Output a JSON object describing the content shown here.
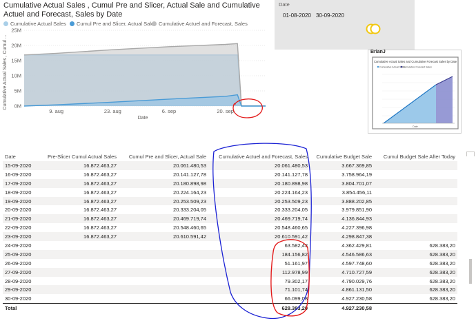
{
  "chart": {
    "title": "Cumulative Actual Sales , Cumul Pre and Slicer, Actual Sale and Cumulative Actuel and Forecast, Sales by Date",
    "legend": [
      {
        "label": "Cumulative Actual Sales",
        "color": "#a9cfe8"
      },
      {
        "label": "Cumul Pre and Slicer, Actual Sale",
        "color": "#4a9bd6"
      },
      {
        "label": "Cumulative Actuel and Forecast, Sales",
        "color": "#bdbdbd"
      }
    ],
    "ylabel": "Cumulative Actual Sales , Cumul ...",
    "xlabel": "Date"
  },
  "chart_data": {
    "type": "area",
    "x": [
      "2020-08-01",
      "2020-08-09",
      "2020-08-23",
      "2020-09-06",
      "2020-09-20",
      "2020-09-23",
      "2020-09-24",
      "2020-09-30"
    ],
    "x_tick_labels": [
      "9. aug",
      "23. aug",
      "6. sep",
      "20. sep"
    ],
    "y_tick_labels": [
      "0M",
      "5M",
      "10M",
      "15M",
      "20M",
      "25M"
    ],
    "ylim": [
      0,
      25000000
    ],
    "series": [
      {
        "name": "Cumulative Actual Sales",
        "values": [
          16872463,
          16872463,
          16872463,
          16872463,
          16872463,
          16872463,
          0,
          0
        ]
      },
      {
        "name": "Cumulative Actuel and Forecast, Sales",
        "values": [
          16872463,
          17400000,
          18600000,
          19600000,
          20333000,
          20610591,
          63582,
          66099
        ]
      },
      {
        "name": "Cumul Pre and Slicer, Actual Sale",
        "values": [
          0,
          400000,
          1300000,
          2300000,
          3200000,
          3738128,
          0,
          0
        ]
      }
    ],
    "grid": true,
    "legend_position": "top-left"
  },
  "slicer": {
    "label": "Date",
    "start": "01-08-2020",
    "end": "30-09-2020"
  },
  "thumbnail": {
    "author": "BrianJ",
    "title": "Cumulative Actual Sales and Cumulative Forecast Sales by Date",
    "legend": [
      "Cumulative Actual Sales",
      "Cumulative Forecast Sales"
    ],
    "xlabel": "Date"
  },
  "table": {
    "columns": [
      "Date",
      "Pre-Slicer Cumul Actual Sales",
      "Cumul Pre and Slicer, Actual Sale",
      "Cumulative Actuel and Forecast, Sales",
      "Cumulative Budget Sale",
      "Cumul Budget Sale After Today"
    ],
    "rows": [
      [
        "15-09-2020",
        "16.872.463,27",
        "20.061.480,53",
        "20.061.480,53",
        "3.667.369,85",
        ""
      ],
      [
        "16-09-2020",
        "16.872.463,27",
        "20.141.127,78",
        "20.141.127,78",
        "3.758.964,19",
        ""
      ],
      [
        "17-09-2020",
        "16.872.463,27",
        "20.180.898,98",
        "20.180.898,98",
        "3.804.701,07",
        ""
      ],
      [
        "18-09-2020",
        "16.872.463,27",
        "20.224.164,23",
        "20.224.164,23",
        "3.854.456,11",
        ""
      ],
      [
        "19-09-2020",
        "16.872.463,27",
        "20.253.509,23",
        "20.253.509,23",
        "3.888.202,85",
        ""
      ],
      [
        "20-09-2020",
        "16.872.463,27",
        "20.333.204,05",
        "20.333.204,05",
        "3.979.851,90",
        ""
      ],
      [
        "21-09-2020",
        "16.872.463,27",
        "20.469.719,74",
        "20.469.719,74",
        "4.136.844,93",
        ""
      ],
      [
        "22-09-2020",
        "16.872.463,27",
        "20.548.460,65",
        "20.548.460,65",
        "4.227.396,98",
        ""
      ],
      [
        "23-09-2020",
        "16.872.463,27",
        "20.610.591,42",
        "20.610.591,42",
        "4.298.847,38",
        ""
      ],
      [
        "24-09-2020",
        "",
        "",
        "63.582,43",
        "4.362.429,81",
        "628.383,20"
      ],
      [
        "25-09-2020",
        "",
        "",
        "184.156,82",
        "4.546.586,63",
        "628.383,20"
      ],
      [
        "26-09-2020",
        "",
        "",
        "51.161,97",
        "4.597.748,60",
        "628.383,20"
      ],
      [
        "27-09-2020",
        "",
        "",
        "112.978,99",
        "4.710.727,59",
        "628.383,20"
      ],
      [
        "28-09-2020",
        "",
        "",
        "79.302,17",
        "4.790.029,76",
        "628.383,20"
      ],
      [
        "29-09-2020",
        "",
        "",
        "71.101,74",
        "4.861.131,50",
        "628.383,20"
      ],
      [
        "30-09-2020",
        "",
        "",
        "66.099,08",
        "4.927.230,58",
        "628.383,20"
      ]
    ],
    "total": [
      "Total",
      "",
      "",
      "628.383,20",
      "4.927.230,58",
      ""
    ]
  }
}
